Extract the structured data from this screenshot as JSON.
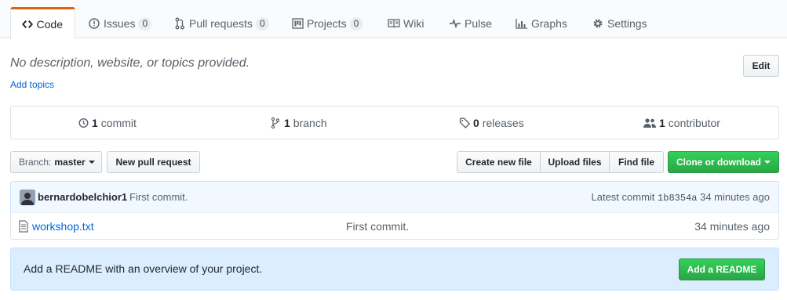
{
  "tabs": [
    {
      "label": "Code",
      "icon": "code-icon",
      "selected": true
    },
    {
      "label": "Issues",
      "icon": "issue-icon",
      "count": "0"
    },
    {
      "label": "Pull requests",
      "icon": "pull-request-icon",
      "count": "0"
    },
    {
      "label": "Projects",
      "icon": "project-icon",
      "count": "0"
    },
    {
      "label": "Wiki",
      "icon": "book-icon"
    },
    {
      "label": "Pulse",
      "icon": "pulse-icon"
    },
    {
      "label": "Graphs",
      "icon": "graph-icon"
    },
    {
      "label": "Settings",
      "icon": "gear-icon"
    }
  ],
  "repo": {
    "description": "No description, website, or topics provided.",
    "add_topics": "Add topics",
    "edit_label": "Edit"
  },
  "summary": {
    "commits": {
      "count": "1",
      "label": "commit"
    },
    "branches": {
      "count": "1",
      "label": "branch"
    },
    "releases": {
      "count": "0",
      "label": "releases"
    },
    "contributors": {
      "count": "1",
      "label": "contributor"
    }
  },
  "toolbar": {
    "branch_prefix": "Branch:",
    "branch_name": "master",
    "new_pr": "New pull request",
    "create_file": "Create new file",
    "upload_files": "Upload files",
    "find_file": "Find file",
    "clone": "Clone or download"
  },
  "commit": {
    "author": "bernardobelchior1",
    "message": "First commit.",
    "latest_prefix": "Latest commit",
    "sha": "1b8354a",
    "age": "34 minutes ago"
  },
  "files": [
    {
      "name": "workshop.txt",
      "message": "First commit.",
      "age": "34 minutes ago"
    }
  ],
  "readme": {
    "text": "Add a README with an overview of your project.",
    "button": "Add a README"
  },
  "colors": {
    "accent_tab": "#e36209",
    "link": "#0366d6",
    "green": "#28a745"
  }
}
